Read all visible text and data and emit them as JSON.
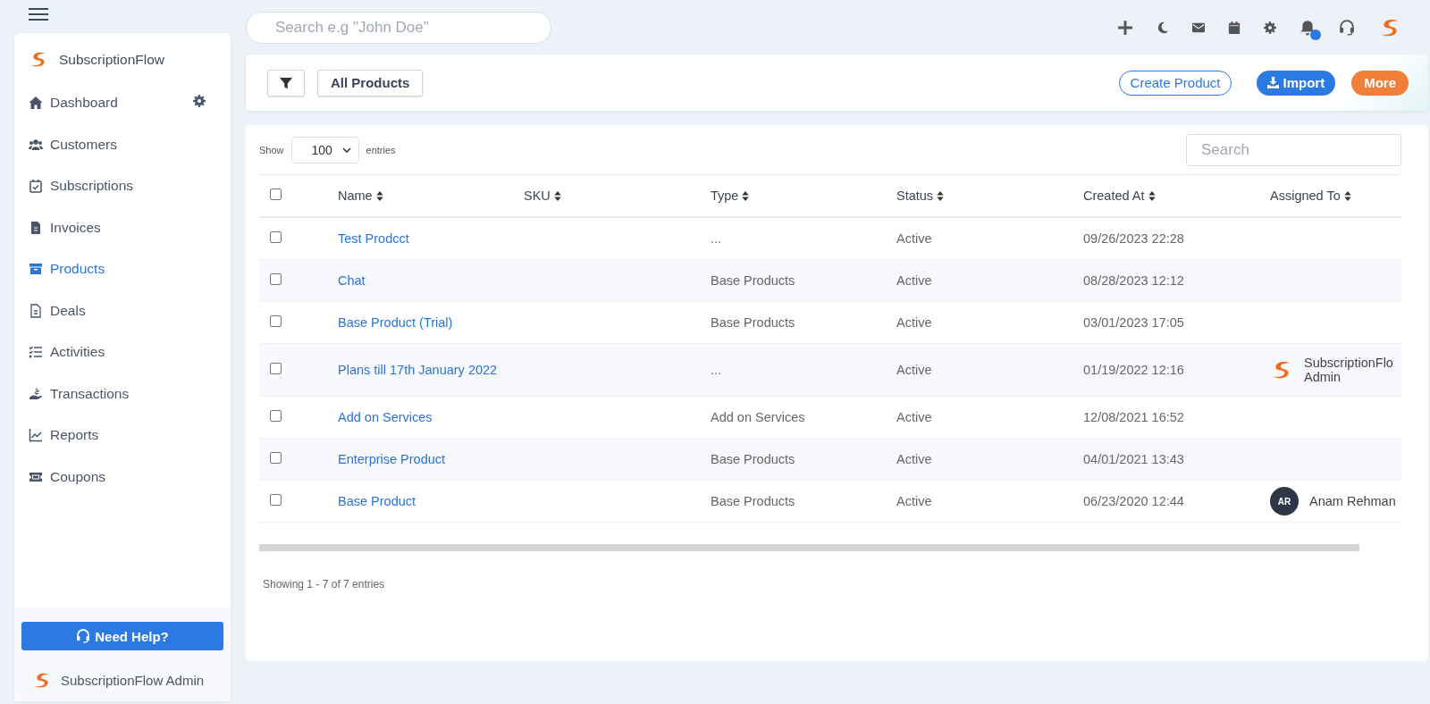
{
  "topbar": {
    "search_placeholder": "Search e.g \"John Doe\"",
    "notification_badge": true
  },
  "sidebar": {
    "brand": "SubscriptionFlow",
    "items": [
      {
        "label": "Dashboard",
        "selected": false
      },
      {
        "label": "Customers",
        "selected": false
      },
      {
        "label": "Subscriptions",
        "selected": false
      },
      {
        "label": "Invoices",
        "selected": false
      },
      {
        "label": "Products",
        "selected": true
      },
      {
        "label": "Deals",
        "selected": false
      },
      {
        "label": "Activities",
        "selected": false
      },
      {
        "label": "Transactions",
        "selected": false
      },
      {
        "label": "Reports",
        "selected": false
      },
      {
        "label": "Coupons",
        "selected": false
      }
    ],
    "help_button": "Need Help?",
    "user": "SubscriptionFlow Admin"
  },
  "toolbar": {
    "view_button": "All Products",
    "create_button": "Create Product",
    "import_button": "Import",
    "more_button": "More"
  },
  "table_controls": {
    "show_label": "Show",
    "entries_value": "100",
    "entries_label": "entries",
    "search_placeholder": "Search"
  },
  "table": {
    "select_all_checked": false,
    "columns": [
      "Name",
      "SKU",
      "Type",
      "Status",
      "Created At",
      "Assigned To"
    ],
    "rows": [
      {
        "checked": false,
        "name": "Test Prodcct",
        "type": "...",
        "status": "Active",
        "created": "09/26/2023 22:28"
      },
      {
        "checked": false,
        "name": "Chat",
        "type": "Base Products",
        "status": "Active",
        "created": "08/28/2023 12:12"
      },
      {
        "checked": false,
        "name": "Base Product (Trial)",
        "type": "Base Products",
        "status": "Active",
        "created": "03/01/2023 17:05"
      },
      {
        "checked": false,
        "name": "Plans till 17th January 2022",
        "type": "...",
        "status": "Active",
        "created": "01/19/2022 12:16",
        "assignee": {
          "kind": "logo",
          "name": "SubscriptionFlo Admin"
        }
      },
      {
        "checked": false,
        "name": "Add on Services",
        "type": "Add on Services",
        "status": "Active",
        "created": "12/08/2021 16:52"
      },
      {
        "checked": false,
        "name": "Enterprise Product",
        "type": "Base Products",
        "status": "Active",
        "created": "04/01/2021 13:43"
      },
      {
        "checked": false,
        "name": "Base Product",
        "type": "Base Products",
        "status": "Active",
        "created": "06/23/2020 12:44",
        "assignee": {
          "kind": "initials",
          "initials": "AR",
          "name": "Anam Rehman"
        }
      }
    ],
    "footer": "Showing 1 - 7 of 7 entries"
  }
}
